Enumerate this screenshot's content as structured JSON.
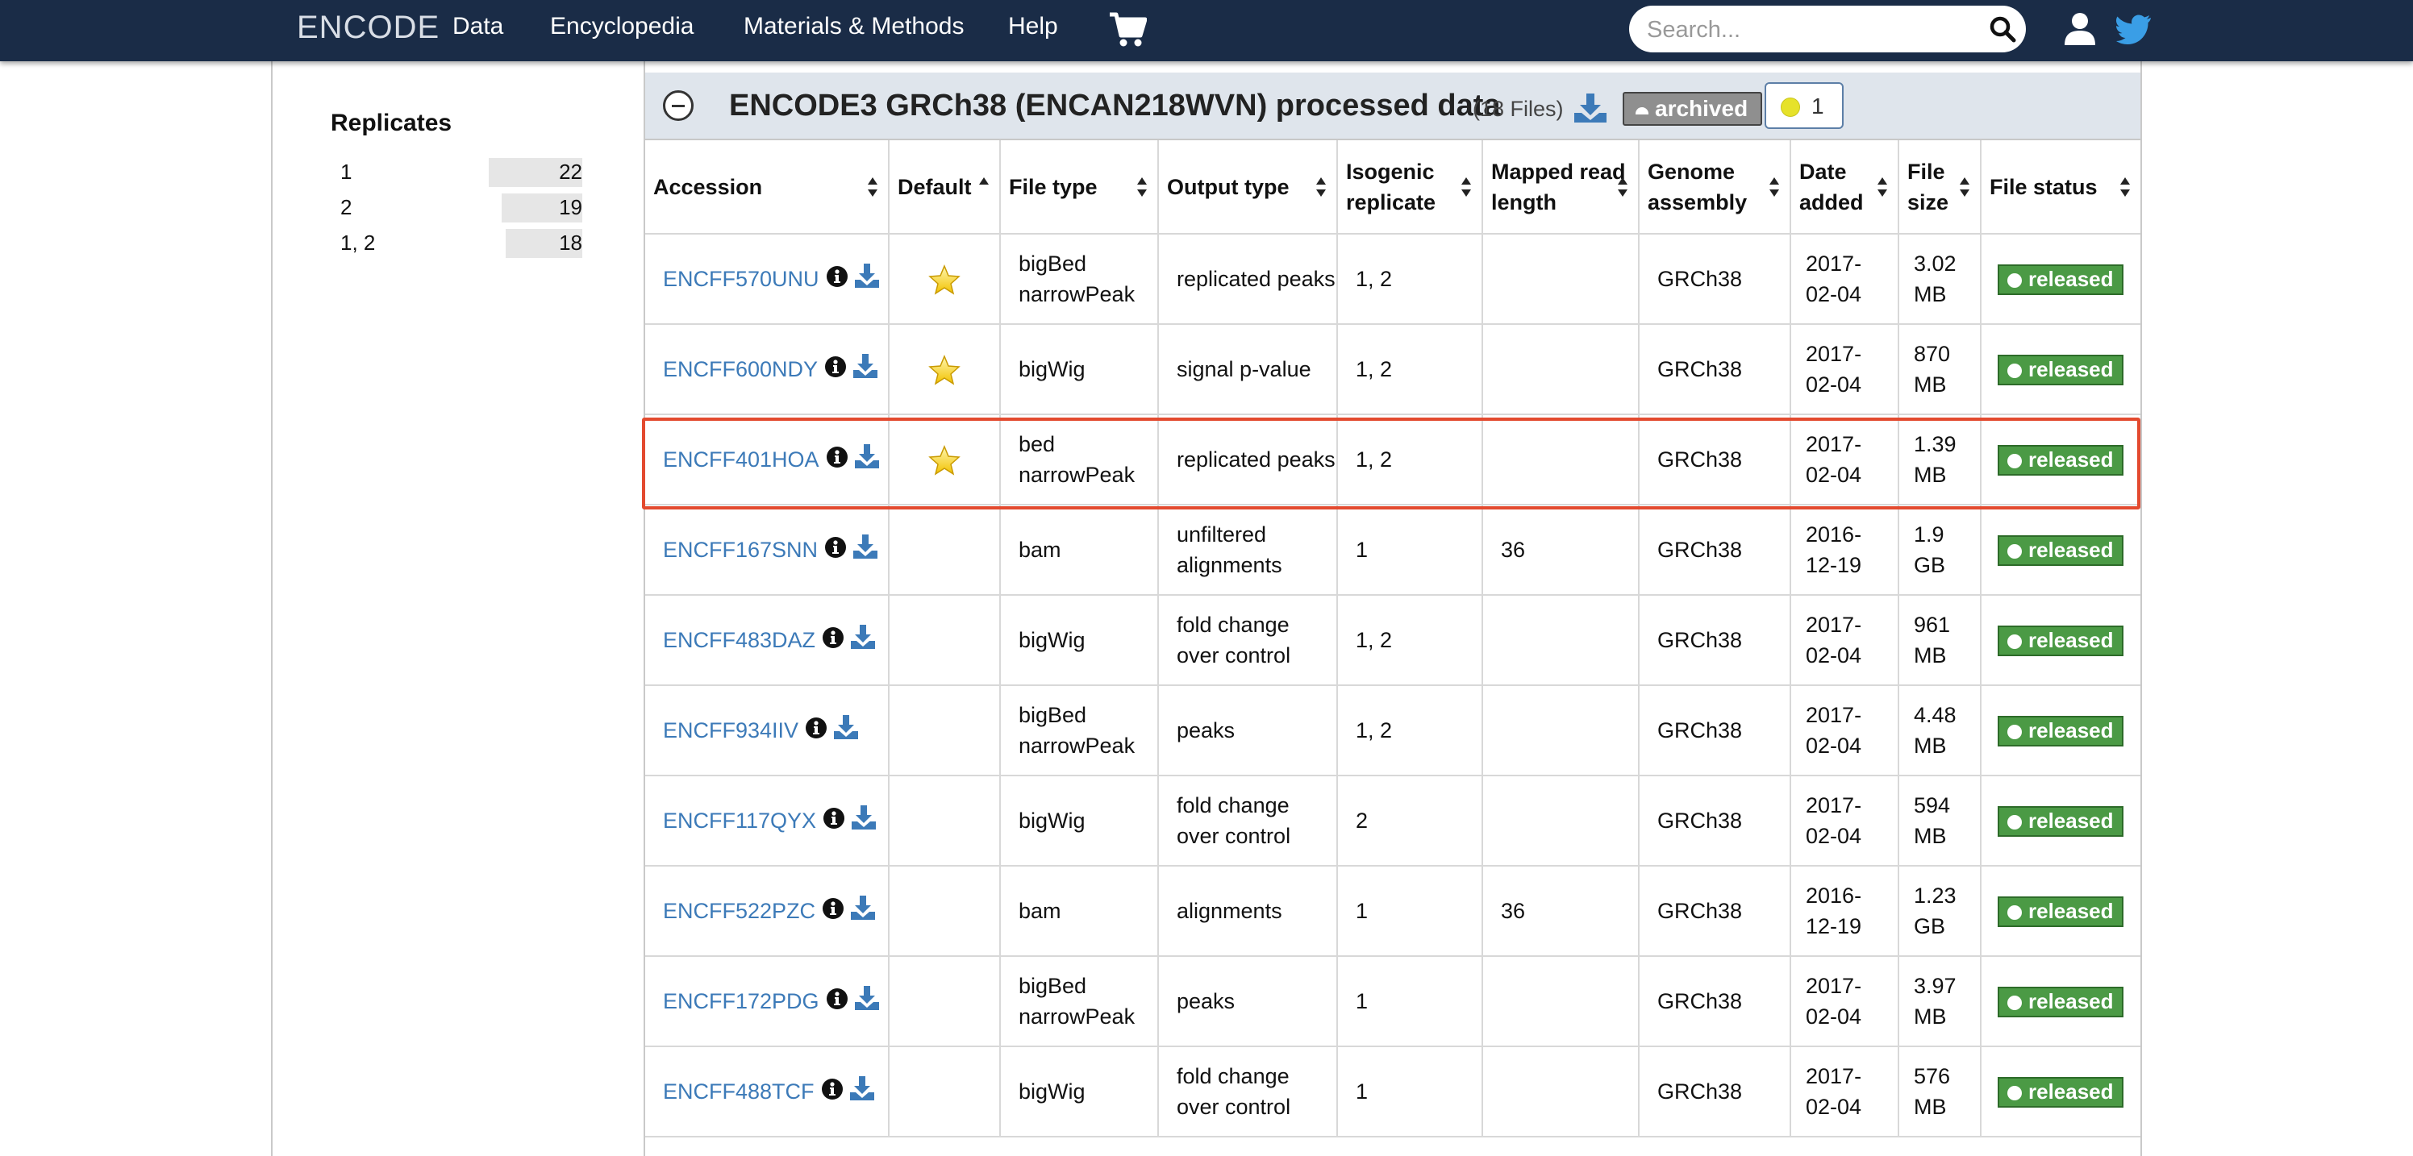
{
  "nav": {
    "brand": "ENCODE",
    "items": [
      "Data",
      "Encyclopedia",
      "Materials & Methods",
      "Help"
    ],
    "search_placeholder": "Search...",
    "icons": [
      "cart-icon",
      "search-icon",
      "user-icon",
      "twitter-icon"
    ]
  },
  "facet": {
    "title": "Replicates",
    "terms": [
      {
        "term": "1",
        "count": "22",
        "fraction": 1.0
      },
      {
        "term": "2",
        "count": "19",
        "fraction": 0.86
      },
      {
        "term": "1, 2",
        "count": "18",
        "fraction": 0.82
      }
    ]
  },
  "group": {
    "title": "ENCODE3 GRCh38 (ENCAN218WVN) processed data",
    "count": "(18 Files)",
    "archived": "archived",
    "audit_count": "1"
  },
  "table": {
    "columns": [
      "Accession",
      "Default",
      "File type",
      "Output type",
      "Isogenic replicate",
      "Mapped read length",
      "Genome assembly",
      "Date added",
      "File size",
      "File status"
    ],
    "rows": [
      {
        "accession": "ENCFF570UNU",
        "default": true,
        "file_type": "bigBed narrowPeak",
        "output_type": "replicated peaks",
        "replicate": "1, 2",
        "read_length": "",
        "assembly": "GRCh38",
        "date": "2017-02-04",
        "size": "3.02 MB",
        "status": "released"
      },
      {
        "accession": "ENCFF600NDY",
        "default": true,
        "file_type": "bigWig",
        "output_type": "signal p-value",
        "replicate": "1, 2",
        "read_length": "",
        "assembly": "GRCh38",
        "date": "2017-02-04",
        "size": "870 MB",
        "status": "released"
      },
      {
        "accession": "ENCFF401HOA",
        "default": true,
        "file_type": "bed narrowPeak",
        "output_type": "replicated peaks",
        "replicate": "1, 2",
        "read_length": "",
        "assembly": "GRCh38",
        "date": "2017-02-04",
        "size": "1.39 MB",
        "status": "released"
      },
      {
        "accession": "ENCFF167SNN",
        "default": false,
        "file_type": "bam",
        "output_type": "unfiltered alignments",
        "replicate": "1",
        "read_length": "36",
        "assembly": "GRCh38",
        "date": "2016-12-19",
        "size": "1.9 GB",
        "status": "released"
      },
      {
        "accession": "ENCFF483DAZ",
        "default": false,
        "file_type": "bigWig",
        "output_type": "fold change over control",
        "replicate": "1, 2",
        "read_length": "",
        "assembly": "GRCh38",
        "date": "2017-02-04",
        "size": "961 MB",
        "status": "released"
      },
      {
        "accession": "ENCFF934IIV",
        "default": false,
        "file_type": "bigBed narrowPeak",
        "output_type": "peaks",
        "replicate": "1, 2",
        "read_length": "",
        "assembly": "GRCh38",
        "date": "2017-02-04",
        "size": "4.48 MB",
        "status": "released"
      },
      {
        "accession": "ENCFF117QYX",
        "default": false,
        "file_type": "bigWig",
        "output_type": "fold change over control",
        "replicate": "2",
        "read_length": "",
        "assembly": "GRCh38",
        "date": "2017-02-04",
        "size": "594 MB",
        "status": "released"
      },
      {
        "accession": "ENCFF522PZC",
        "default": false,
        "file_type": "bam",
        "output_type": "alignments",
        "replicate": "1",
        "read_length": "36",
        "assembly": "GRCh38",
        "date": "2016-12-19",
        "size": "1.23 GB",
        "status": "released"
      },
      {
        "accession": "ENCFF172PDG",
        "default": false,
        "file_type": "bigBed narrowPeak",
        "output_type": "peaks",
        "replicate": "1",
        "read_length": "",
        "assembly": "GRCh38",
        "date": "2017-02-04",
        "size": "3.97 MB",
        "status": "released"
      },
      {
        "accession": "ENCFF488TCF",
        "default": false,
        "file_type": "bigWig",
        "output_type": "fold change over control",
        "replicate": "1",
        "read_length": "",
        "assembly": "GRCh38",
        "date": "2017-02-04",
        "size": "576 MB",
        "status": "released"
      }
    ],
    "highlighted_row": "ENCFF401HOA"
  },
  "colors": {
    "nav_bg": "#1a2c47",
    "link": "#3c7ab8",
    "released": "#4b9a45",
    "highlight": "#e34a2f",
    "group_header_bg": "#dfe5ec"
  }
}
